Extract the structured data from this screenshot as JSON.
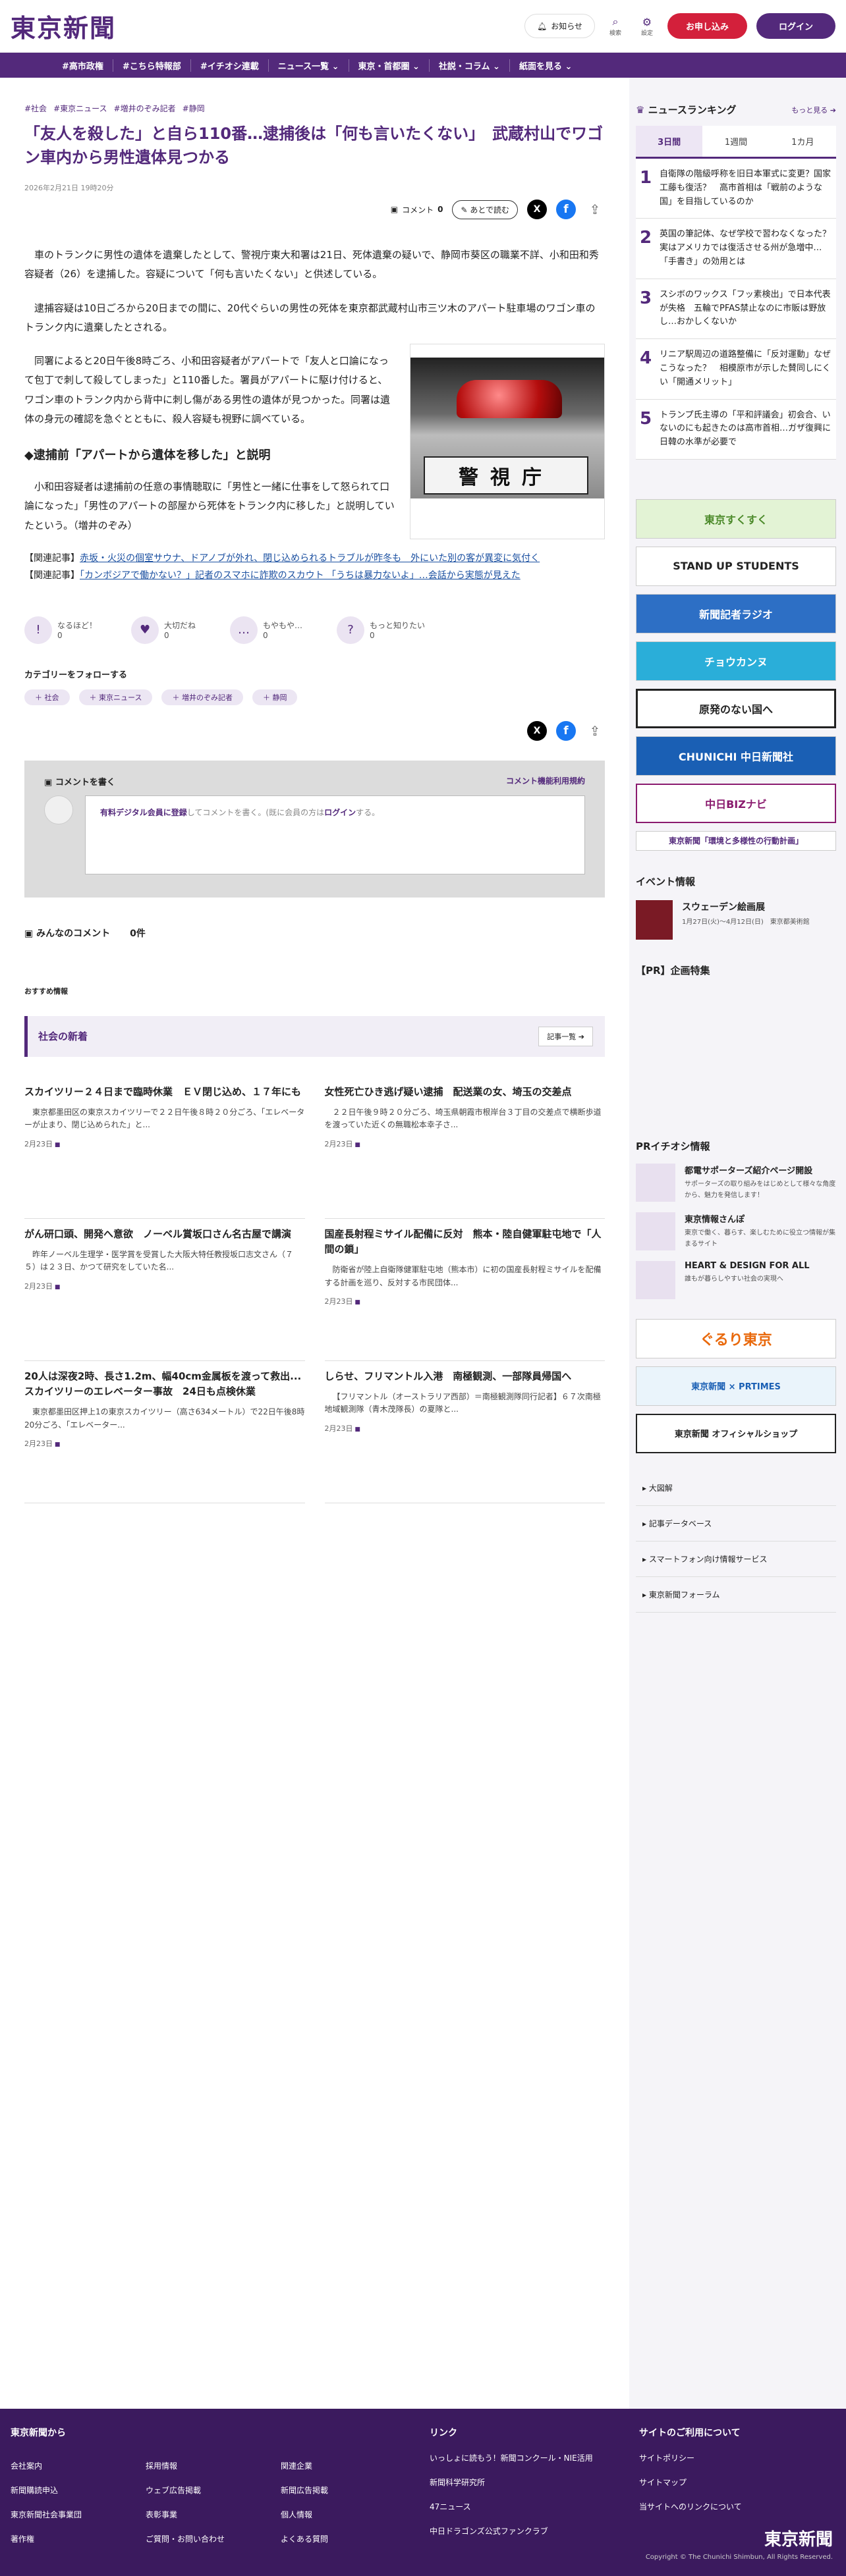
{
  "header": {
    "logo": "東京新聞",
    "notice": "お知らせ",
    "search": "検索",
    "settings": "設定",
    "subscribe": "お申し込み",
    "login": "ログイン"
  },
  "nav": [
    "#高市政権",
    "#こちら特報部",
    "#イチオシ連載",
    "ニュース一覧 ⌄",
    "東京・首都圏 ⌄",
    "社説・コラム ⌄",
    "紙面を見る ⌄"
  ],
  "article": {
    "tags": [
      "#社会",
      "#東京ニュース",
      "#増井のぞみ記者",
      "#静岡"
    ],
    "title": "「友人を殺した」と自ら110番…逮捕後は「何も言いたくない」　武蔵村山でワゴン車内から男性遺体見つかる",
    "date": "2026年2月21日 19時20分",
    "comment_label": "コメント",
    "comment_count": "0",
    "later": "あとで読む",
    "p1": "車のトランクに男性の遺体を遺棄したとして、警視庁東大和署は21日、死体遺棄の疑いで、静岡市葵区の職業不詳、小和田和秀容疑者（26）を逮捕した。容疑について「何も言いたくない」と供述している。",
    "p2": "逮捕容疑は10日ごろから20日までの間に、20代ぐらいの男性の死体を東京都武蔵村山市三ツ木のアパート駐車場のワゴン車のトランク内に遺棄したとされる。",
    "p3": "同署によると20日午後8時ごろ、小和田容疑者がアパートで「友人と口論になって包丁で刺して殺してしまった」と110番した。署員がアパートに駆け付けると、ワゴン車のトランク内から背中に刺し傷がある男性の遺体が見つかった。同署は遺体の身元の確認を急ぐとともに、殺人容疑も視野に調べている。",
    "photo_text": "警視庁",
    "h2": "◆逮捕前「アパートから遺体を移した」と説明",
    "p4": "小和田容疑者は逮捕前の任意の事情聴取に「男性と一緒に仕事をして怒られて口論になった」「男性のアパートの部屋から死体をトランク内に移した」と説明していたという。（増井のぞみ）",
    "rel1_label": "【関連記事】",
    "rel1": "赤坂・火災の個室サウナ、ドアノブが外れ、閉じ込められるトラブルが昨冬も　外にいた別の客が異変に気付く",
    "rel2_label": "【関連記事】",
    "rel2": "「カンボジアで働かない？」記者のスマホに詐欺のスカウト 「うちは暴力ないよ」…会話から実態が見えた"
  },
  "reactions": [
    {
      "label": "なるほど！",
      "count": "0",
      "icon": "!"
    },
    {
      "label": "大切だね",
      "count": "0",
      "icon": "♥"
    },
    {
      "label": "もやもや…",
      "count": "0",
      "icon": "…"
    },
    {
      "label": "もっと知りたい",
      "count": "0",
      "icon": "?"
    }
  ],
  "follow": {
    "title": "カテゴリーをフォローする",
    "chips": [
      "＋ 社会",
      "＋ 東京ニュース",
      "＋ 増井のぞみ記者",
      "＋ 静岡"
    ]
  },
  "comment_box": {
    "title": "コメントを書く",
    "policy": "コメント機能利用規約",
    "link1": "有料デジタル会員に登録",
    "text1": "してコメントを書く。(既に会員の方は",
    "link2": "ログイン",
    "text2": "する。"
  },
  "everyone": {
    "label": "みんなのコメント",
    "count": "0件"
  },
  "recommend": "おすすめ情報",
  "latest": {
    "title": "社会の新着",
    "more": "記事一覧  ➔"
  },
  "cards": [
    {
      "title": "スカイツリー２４日まで臨時休業　ＥＶ閉じ込め、１７年にも",
      "summary": "東京都墨田区の東京スカイツリーで２２日午後８時２０分ごろ、「エレベーターが止まり、閉じ込められた」と...",
      "date": "2月23日"
    },
    {
      "title": "女性死亡ひき逃げ疑い逮捕　配送業の女、埼玉の交差点",
      "summary": "２２日午後９時２０分ごろ、埼玉県朝霞市根岸台３丁目の交差点で横断歩道を渡っていた近くの無職松本幸子さ...",
      "date": "2月23日"
    },
    {
      "title": "がん研口頭、開発へ意欲　ノーベル賞坂口さん名古屋で講演",
      "summary": "昨年ノーベル生理学・医学賞を受賞した大阪大特任教授坂口志文さん（７５）は２３日、かつて研究をしていた名...",
      "date": "2月23日"
    },
    {
      "title": "国産長射程ミサイル配備に反対　熊本・陸自健軍駐屯地で「人間の鎖」",
      "summary": "防衛省が陸上自衛隊健軍駐屯地（熊本市）に初の国産長射程ミサイルを配備する計画を巡り、反対する市民団体...",
      "date": "2月23日"
    },
    {
      "title": "20人は深夜2時、長さ1.2m、幅40cm金属板を渡って救出...スカイツリーのエレベーター事故　24日も点検休業",
      "summary": "東京都墨田区押上1の東京スカイツリー（高さ634メートル）で22日午後8時20分ごろ、「エレベーター...",
      "date": "2月23日"
    },
    {
      "title": "しらせ、フリマントル入港　南極観測、一部隊員帰国へ",
      "summary": "【フリマントル（オーストラリア西部）＝南極観測隊同行記者】６７次南極地域観測隊（青木茂隊長）の夏隊と...",
      "date": "2月23日"
    }
  ],
  "ranking": {
    "title": "ニュースランキング",
    "more": "もっと見る ➔",
    "tabs": [
      "3日間",
      "1週間",
      "1カ月"
    ],
    "items": [
      {
        "n": "1",
        "text": "自衛隊の階級呼称を旧日本軍式に変更？国家工藤も復活？　高市首相は「戦前のような国」を目指しているのか"
      },
      {
        "n": "2",
        "text": "英国の筆記体、なぜ学校で習わなくなった？　実はアメリカでは復活させる州が急増中…「手書き」の効用とは"
      },
      {
        "n": "3",
        "text": "スシボのワックス「フッ素検出」で日本代表が失格　五輪でPFAS禁止なのに市販は野放し…おかしくないか"
      },
      {
        "n": "4",
        "text": "リニア駅周辺の道路整備に「反対運動」なぜこうなった？　相模原市が示した賛同しにくい「開通メリット」"
      },
      {
        "n": "5",
        "text": "トランプ氏主導の「平和評議会」初会合、いないのにも起きたのは高市首相…ガザ復興に日韓の水準が必要で"
      }
    ]
  },
  "banners": [
    "東京すくすく",
    "STAND UP STUDENTS",
    "新聞記者ラジオ",
    "チョウカンヌ",
    "原発のない国へ",
    "CHUNICHI 中日新聞社",
    "中日BIZナビ",
    "東京新聞「環境と多様性の行動計画」"
  ],
  "event": {
    "title": "イベント情報",
    "name": "スウェーデン絵画展",
    "detail": "1月27日(火)〜4月12日(日)　東京都美術館"
  },
  "pr": {
    "title": "【PR】企画特集",
    "pick": "PRイチオシ情報",
    "items": [
      {
        "t": "都電サポーターズ紹介ページ開設",
        "d": "サポーターズの取り組みをはじめとして様々な角度から、魅力を発信します！"
      },
      {
        "t": "東京情報さんぽ",
        "d": "東京で働く、暮らす、楽しむために役立つ情報が集まるサイト"
      },
      {
        "t": "HEART & DESIGN FOR ALL",
        "d": "誰もが暮らしやすい社会の実現へ"
      }
    ]
  },
  "banners2": [
    "ぐるり東京",
    "東京新聞 × PRTIMES",
    "東京新聞 オフィシャルショップ"
  ],
  "side_links": [
    "大図解",
    "記事データベース",
    "スマートフォン向け情報サービス",
    "東京新聞フォーラム"
  ],
  "footer": {
    "c1_title": "東京新聞から",
    "c1": [
      "会社案内",
      "新聞購読申込",
      "東京新聞社会事業団",
      "著作権",
      "採用情報",
      "ウェブ広告掲載",
      "表彰事業",
      "ご質問・お問い合わせ",
      "関連企業",
      "新聞広告掲載",
      "個人情報",
      "よくある質問"
    ],
    "c2_title": "リンク",
    "c2": [
      "いっしょに読もう！新聞コンクール・NIE活用",
      "新聞科学研究所",
      "47ニュース",
      "中日ドラゴンズ公式ファンクラブ"
    ],
    "c3_title": "サイトのご利用について",
    "c3": [
      "サイトポリシー",
      "サイトマップ",
      "当サイトへのリンクについて"
    ],
    "logo": "東京新聞",
    "copy": "Copyright © The Chunichi Shimbun, All Rights Reserved."
  }
}
